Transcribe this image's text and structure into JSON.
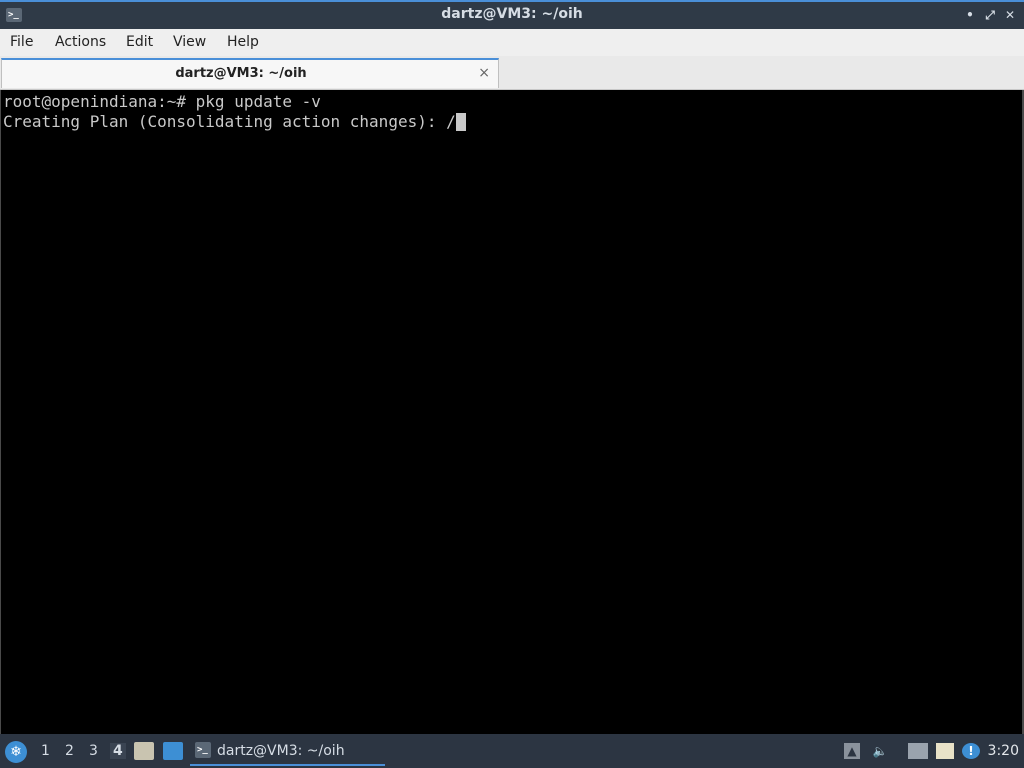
{
  "window": {
    "title": "dartz@VM3: ~/oih",
    "app_icon": ">_",
    "minimize_glyph": "•",
    "maximize_glyph": "⤢",
    "close_glyph": "✕"
  },
  "menu": [
    "File",
    "Actions",
    "Edit",
    "View",
    "Help"
  ],
  "tab": {
    "label": "dartz@VM3: ~/oih",
    "close_glyph": "×"
  },
  "terminal": {
    "lines": [
      "root@openindiana:~# pkg update -v",
      "Creating Plan (Consolidating action changes): /"
    ]
  },
  "taskbar": {
    "start_glyph": "❄",
    "workspaces": [
      "1",
      "2",
      "3",
      "4"
    ],
    "active_workspace": "4",
    "task_label": "dartz@VM3: ~/oih",
    "task_icon": ">_",
    "tray_icons": [
      "upload-icon",
      "volume-icon",
      "network-icon",
      "clipboard-icon",
      "notification-icon"
    ],
    "clock": "3:20"
  },
  "colors": {
    "accent": "#4a8fd8",
    "panel": "#2c3542",
    "terminal_bg": "#000000",
    "terminal_fg": "#c9c9c9"
  }
}
